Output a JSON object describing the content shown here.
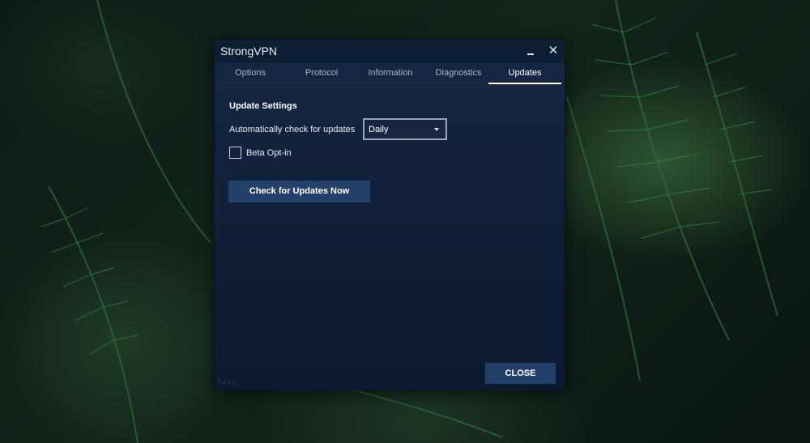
{
  "window": {
    "title": "StrongVPN",
    "minimize_icon": "minimize-icon",
    "close_icon": "close-icon",
    "close_glyph": "✕"
  },
  "tabs": [
    {
      "label": "Options",
      "active": false
    },
    {
      "label": "Protocol",
      "active": false
    },
    {
      "label": "Information",
      "active": false
    },
    {
      "label": "Diagnostics",
      "active": false
    },
    {
      "label": "Updates",
      "active": true
    }
  ],
  "updates": {
    "section_title": "Update Settings",
    "auto_check_label": "Automatically check for updates",
    "auto_check_value": "Daily",
    "beta_label": "Beta Opt-in",
    "beta_checked": false,
    "check_now_label": "Check for Updates Now"
  },
  "footer": {
    "close_label": "CLOSE",
    "version": "2.2.1.0"
  },
  "colors": {
    "window_bg": "#132641",
    "button_bg": "#25416b",
    "active_tab_underline": "#ffffff"
  }
}
